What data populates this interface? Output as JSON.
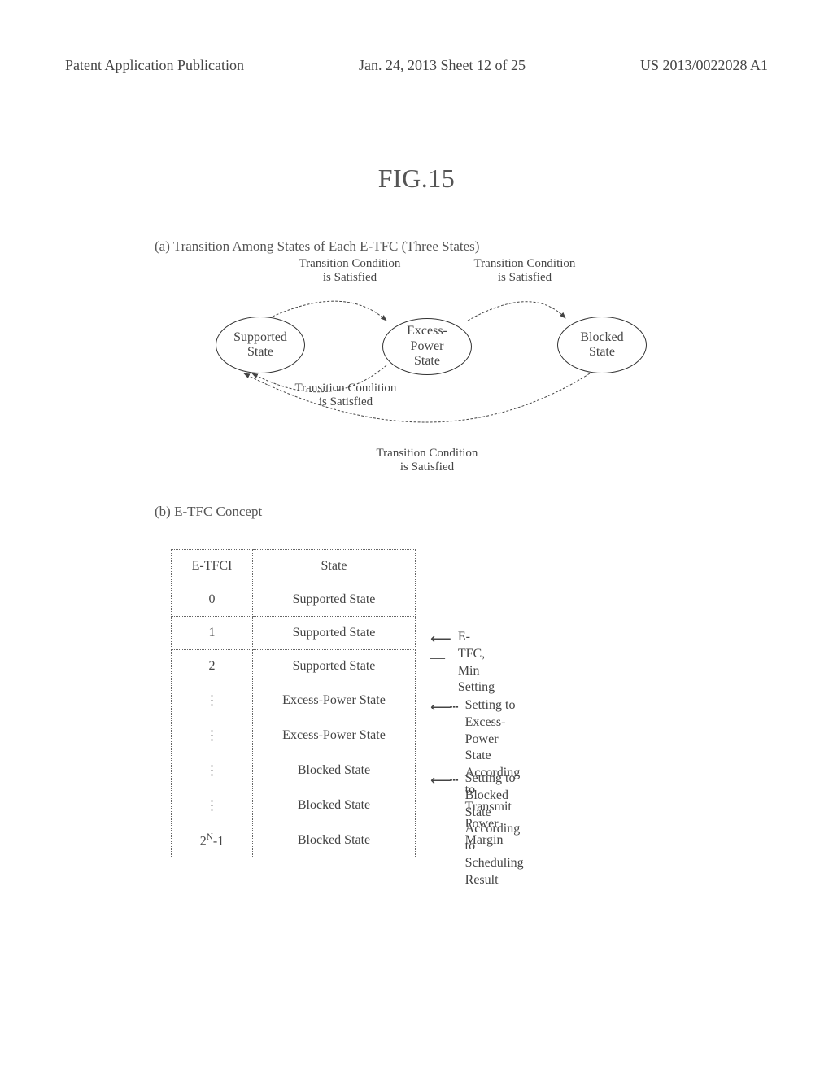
{
  "header": {
    "left": "Patent Application Publication",
    "mid": "Jan. 24, 2013  Sheet 12 of 25",
    "right": "US 2013/0022028 A1"
  },
  "figure_title": "FIG.15",
  "section_a": {
    "label": "(a)  Transition Among States of Each E-TFC (Three States)",
    "supported": "Supported\nState",
    "excess": "Excess-\nPower\nState",
    "blocked": "Blocked\nState",
    "trans_top_left": "Transition Condition\nis Satisfied",
    "trans_top_right": "Transition Condition\nis Satisfied",
    "trans_mid": "Transition Condition\nis Satisfied",
    "trans_bottom": "Transition Condition\nis Satisfied"
  },
  "section_b": {
    "label": "(b)  E-TFC Concept",
    "col_id": "E-TFCI",
    "col_state": "State",
    "rows": [
      {
        "id": "0",
        "state": "Supported State"
      },
      {
        "id": "1",
        "state": "Supported State"
      },
      {
        "id": "2",
        "state": "Supported State"
      },
      {
        "id": "⋮",
        "state": "Excess-Power State"
      },
      {
        "id": "⋮",
        "state": "Excess-Power State"
      },
      {
        "id": "⋮",
        "state": "Blocked State"
      },
      {
        "id": "⋮",
        "state": "Blocked State"
      },
      {
        "id": "2ᴺ-1",
        "state": "Blocked State"
      }
    ],
    "annotations": {
      "a1": "E-TFC, Min Setting",
      "a2": "Setting to Excess-Power State\nAccording to Transmit Power Margin",
      "a3": "Setting to Blocked State\nAccording to Scheduling Result"
    }
  },
  "chart_data": {
    "type": "table",
    "title": "E-TFC Concept",
    "columns": [
      "E-TFCI",
      "State"
    ],
    "rows": [
      [
        "0",
        "Supported State"
      ],
      [
        "1",
        "Supported State"
      ],
      [
        "2",
        "Supported State"
      ],
      [
        "⋮",
        "Excess-Power State"
      ],
      [
        "⋮",
        "Excess-Power State"
      ],
      [
        "⋮",
        "Blocked State"
      ],
      [
        "⋮",
        "Blocked State"
      ],
      [
        "2^N - 1",
        "Blocked State"
      ]
    ],
    "annotations": [
      {
        "row_index": 1,
        "text": "E-TFC, Min Setting",
        "style": "solid"
      },
      {
        "row_index": 3,
        "text": "Setting to Excess-Power State According to Transmit Power Margin",
        "style": "dashed"
      },
      {
        "row_index": 5,
        "text": "Setting to Blocked State According to Scheduling Result",
        "style": "dashed"
      }
    ]
  }
}
